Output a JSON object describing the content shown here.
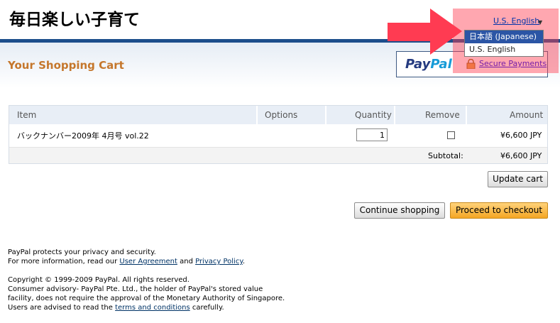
{
  "site": {
    "title": "毎日楽しい子育て"
  },
  "language": {
    "current": "U.S. English",
    "options": [
      "日本語 (Japanese)",
      "U.S. English"
    ],
    "highlighted_index": 0
  },
  "cart": {
    "heading": "Your Shopping Cart",
    "paypal": {
      "pay": "Pay",
      "pal": "Pal",
      "secure_label": "Secure Payments"
    },
    "columns": {
      "item": "Item",
      "options": "Options",
      "quantity": "Quantity",
      "remove": "Remove",
      "amount": "Amount"
    },
    "row": {
      "item": "バックナンバー2009年 4月号 vol.22",
      "quantity": "1",
      "amount": "¥6,600 JPY"
    },
    "subtotal": {
      "label": "Subtotal:",
      "value": "¥6,600 JPY"
    },
    "buttons": {
      "update": "Update cart",
      "continue": "Continue shopping",
      "checkout": "Proceed to checkout"
    }
  },
  "footer": {
    "privacy_line1": "PayPal protects your privacy and security.",
    "privacy_line2_pre": "For more information, read our ",
    "user_agreement": "User Agreement",
    "and": " and ",
    "privacy_policy": "Privacy Policy",
    "period": ".",
    "copyright": "Copyright © 1999-2009 PayPal. All rights reserved.",
    "advisory1": "Consumer advisory- PayPal Pte. Ltd., the holder of PayPal's stored value",
    "advisory2": "facility, does not require the approval of the Monetary Authority of Singapore.",
    "advisory3_pre": "Users are advised to read the ",
    "terms": "terms and conditions",
    "advisory3_post": " carefully."
  },
  "colors": {
    "accent_rule": "#1c4e8b",
    "heading": "#c5772c",
    "checkout": "#f4a623",
    "highlight": "#ff3c50"
  }
}
